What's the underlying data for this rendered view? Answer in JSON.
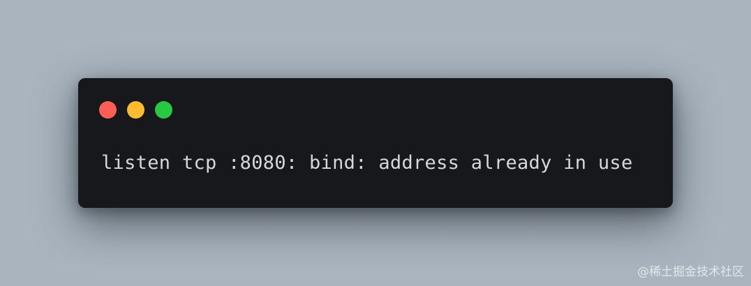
{
  "colors": {
    "page_background": "#a9b4be",
    "window_background": "#17181b",
    "text": "#d6d8da",
    "close_light": "#ff5f57",
    "minimize_light": "#febc2e",
    "maximize_light": "#28c840"
  },
  "window": {
    "traffic_lights": [
      {
        "name": "close-light",
        "color": "#ff5f57"
      },
      {
        "name": "minimize-light",
        "color": "#febc2e"
      },
      {
        "name": "maximize-light",
        "color": "#28c840"
      }
    ],
    "code": "listen tcp :8080: bind: address already in use"
  },
  "watermark": "@稀土掘金技术社区"
}
